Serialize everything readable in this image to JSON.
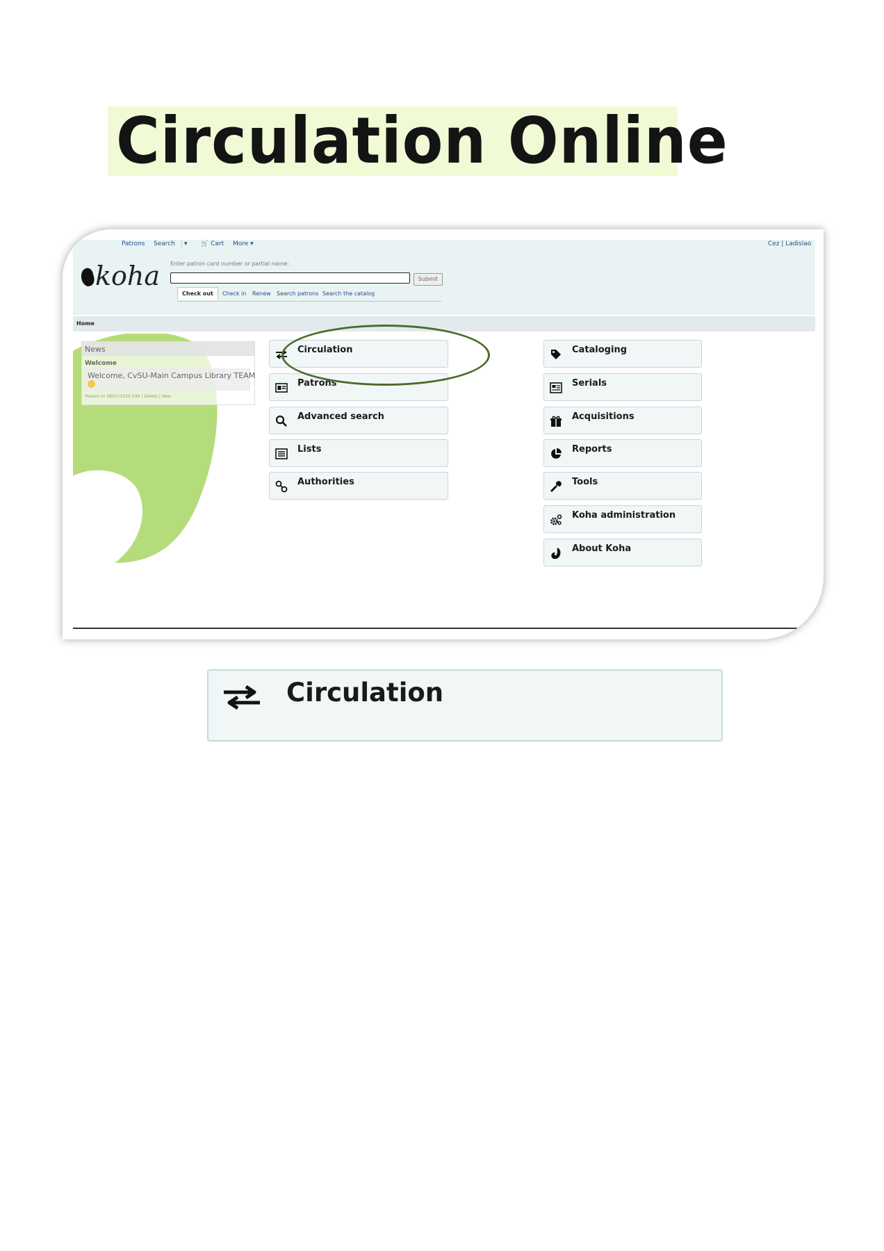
{
  "page": {
    "title": "Circulation Online"
  },
  "koha": {
    "topnav": {
      "patrons": "Patrons",
      "search": "Search",
      "caret": "▾",
      "cart": "Cart",
      "more": "More ▾",
      "user": "Cez | Ladislao"
    },
    "logo_text": "koha",
    "patron_search": {
      "label": "Enter patron card number or partial name:",
      "value": "",
      "submit": "Submit"
    },
    "circ_tabs": [
      "Check out",
      "Check in",
      "Renew",
      "Search patrons",
      "Search the catalog"
    ],
    "breadcrumb": "Home",
    "news": {
      "title": "News",
      "subtitle": "Welcome",
      "body": "Welcome, CvSU-Main Campus Library TEAM",
      "meta": "Posted on 08/07/2020 Edit | Delete | New"
    },
    "modules_left": [
      "Circulation",
      "Patrons",
      "Advanced search",
      "Lists",
      "Authorities"
    ],
    "modules_right": [
      "Cataloging",
      "Serials",
      "Acquisitions",
      "Reports",
      "Tools",
      "Koha administration",
      "About Koha"
    ]
  },
  "zoom": {
    "label": "Circulation"
  },
  "colors": {
    "title_highlight": "#f0fbd6",
    "koha_green": "#b5dc7a",
    "ellipse": "#4d6b2a",
    "tile_bg": "#f1f6f7"
  }
}
